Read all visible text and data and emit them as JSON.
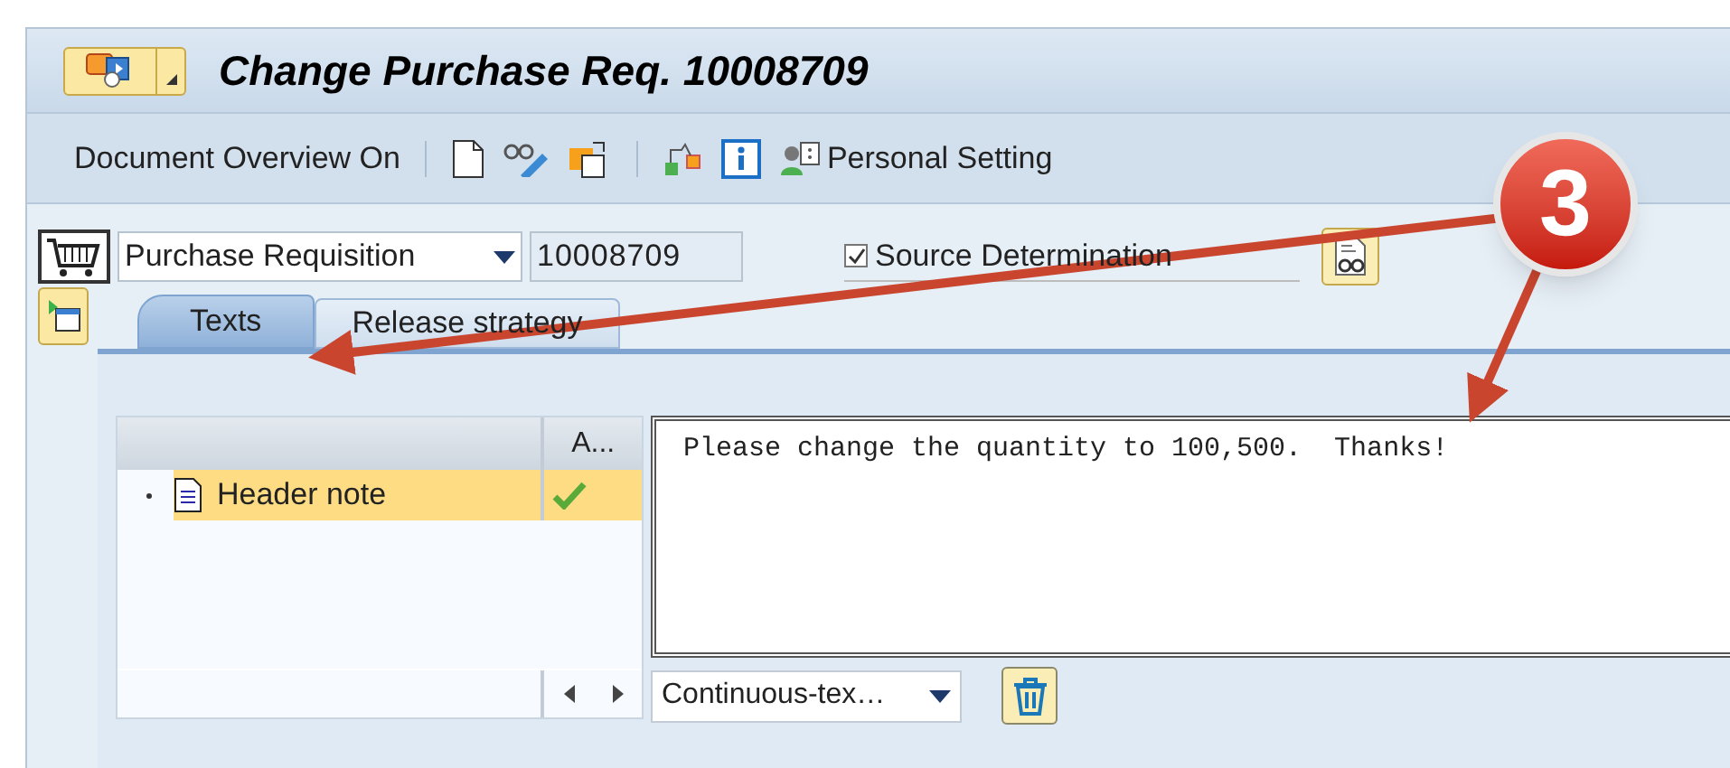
{
  "window": {
    "title": "Change Purchase Req. 10008709"
  },
  "toolbar": {
    "document_overview_button": "Document Overview On",
    "personal_setting_button": "Personal Setting"
  },
  "header": {
    "document_type": "Purchase Requisition",
    "document_number": "10008709",
    "source_determination": {
      "label": "Source Determination",
      "checked": true
    }
  },
  "tabs": [
    {
      "label": "Texts",
      "selected": true
    },
    {
      "label": "Release strategy",
      "selected": false
    }
  ],
  "text_tree": {
    "column_2_header": "A...",
    "rows": [
      {
        "label": "Header note",
        "selected": true,
        "checked": true
      }
    ]
  },
  "editor": {
    "value": "Please change the quantity to 100,500.  Thanks!"
  },
  "format_select": {
    "value": "Continuous-tex…"
  },
  "annotation": {
    "label": "3"
  }
}
